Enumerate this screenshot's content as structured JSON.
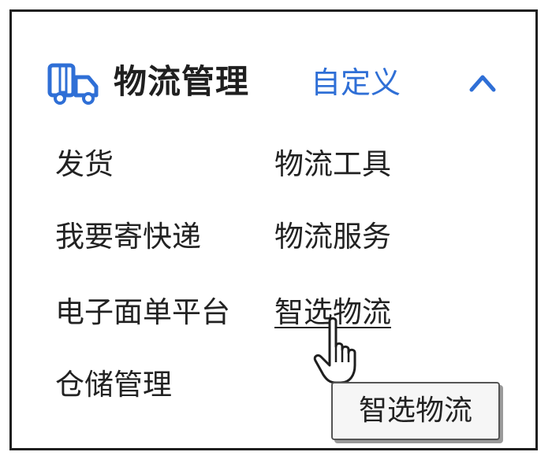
{
  "panel": {
    "title": "物流管理",
    "customize_label": "自定义",
    "icon": "truck-icon",
    "collapse_icon": "chevron-up-icon",
    "accent_color": "#2f6fd6"
  },
  "menu": {
    "left": [
      "发货",
      "我要寄快递",
      "电子面单平台",
      "仓储管理"
    ],
    "right": [
      "物流工具",
      "物流服务",
      "智选物流"
    ]
  },
  "tooltip": {
    "text": "智选物流"
  }
}
